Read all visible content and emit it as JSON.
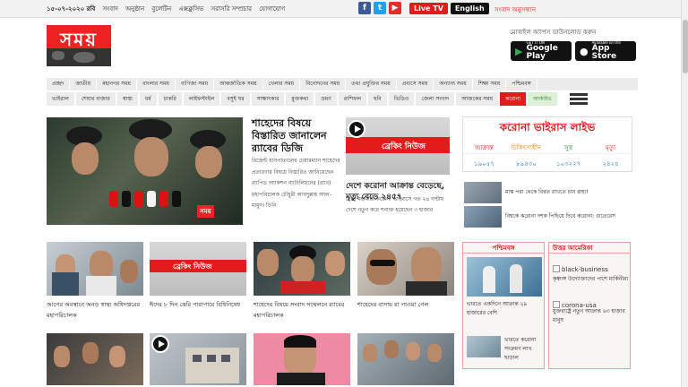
{
  "topbar": {
    "date": "১৫-০৭-২০২০ রবি",
    "links": [
      "সংবাদ",
      "অনুষ্ঠান",
      "বুলেটিন",
      "এক্সক্লুসিভ",
      "সরাসরি সম্প্রচার",
      "যোগাযোগ"
    ],
    "social": [
      {
        "icon": "facebook-icon",
        "glyph": "f",
        "color": "#3b5998"
      },
      {
        "icon": "twitter-icon",
        "glyph": "t",
        "color": "#1da1f2"
      },
      {
        "icon": "youtube-icon",
        "glyph": "▶",
        "color": "#e52d27"
      }
    ],
    "live_tv": "Live TV",
    "english": "English",
    "subscribe": "সংবাদ অনুসন্ধান"
  },
  "header": {
    "logo_text": "সময়",
    "app_download": "মোবাইল অ্যাপস ডাউনলোড করুন",
    "google_play": {
      "small": "GET IT ON",
      "big": "Google Play"
    },
    "app_store": {
      "small": "Available on the",
      "big": "App Store"
    }
  },
  "nav1": [
    "প্রচ্ছদ",
    "জাতীয়",
    "মহানগর সময়",
    "বাংলার সময়",
    "বাণিজ্য সময়",
    "আন্তর্জাতিক সময়",
    "খেলার সময়",
    "বিনোদনের সময়",
    "তথ্য প্রযুক্তির সময়",
    "প্রবাসে সময়",
    "অন্যান্য সময়",
    "শিক্ষা সময়",
    "পশ্চিমবঙ্গ"
  ],
  "nav2": [
    "ভাইরাল",
    "শেয়ার বাজার",
    "স্বাস্থ্য",
    "ধর্ম",
    "চাকরি",
    "লাইফস্টাইল",
    "বসুই ঘর",
    "সাক্ষাৎকার",
    "মুক্তকথা",
    "ভ্রমণ",
    "রাশিফল",
    "ছবি",
    "ভিডিও",
    "জেলা সংবাদ",
    "আজকের সময়"
  ],
  "nav2_red": "করোনা",
  "nav2_green": "আর্কাইভ",
  "hero": {
    "tag": "সময়",
    "title": "শাহেদের বিষয়ে বিস্তারিত জানালেন র‍্যাবের ডিজি",
    "text": "রিজেন্ট হাসপাতালের চেয়ারম্যান শাহেদের প্রতারণার বিষয়ে বিস্তারিত জানিয়েছেন র‍্যাপিড অ্যাকশন ব্যাটালিয়নের (র‍্যাব) মহাপরিচালক চৌধুরী আবদুল্লাহ আল-মামুন। তিনি"
  },
  "breaking": "ব্রেকিং নিউজ",
  "mid": {
    "title": "দেশে করোনা আক্রান্ত বেড়েছে, মৃত্যু বেড়ে ২৪৫৭",
    "text": "দেশে মহামারী করোনা ভাইরাসে গত ২৪ ঘণ্টায় দেশে নতুন করে শনাক্ত হয়েছেন ৩ হাজার"
  },
  "corona": {
    "title": "করোনা ভাইরাস লাইভ",
    "labels": [
      "আক্রান্ত",
      "চিকিৎসাধীন",
      "সুস্থ",
      "মৃত্যু"
    ],
    "values": [
      "১৯০৫৭",
      "৮৯৪৩০",
      "১০৩২২৭",
      "২৪২৪"
    ]
  },
  "side": [
    "মাস্ক পরা থেকে বিরত রাখতে চান রাহা!",
    "বিশ্বকে করোনা দশক পিছিয়ে দিবে করোনা: গুতেরেস"
  ],
  "cards": [
    "আগের অবস্থানে অনড় স্বাস্থ্য অধিদপ্তরের মহাপরিচালক",
    "ঈদের ৮ দিন কেরি পারাপারে বিধিনিষেধ",
    "শাহেদের বিষয়ে সংবাদ সম্মেলনে র‍্যাবের মহাপরিচালক",
    "শাহেদের বাসায় যা পাওয়া গেল"
  ],
  "box_west": {
    "title": "পশ্চিমবঙ্গ",
    "t1": "ভারতে একদিনে আক্রান্ত ২৯ হাজারের বেশি",
    "t2": "ভারতে করোনা সংক্রমণ লাখ ছাড়াল"
  },
  "box_na": {
    "title": "উত্তর আমেরিকা",
    "img1": "black-business",
    "t1": "কৃষ্ণাঙ্গ উদ্যোক্তাদের পাশে মার্কিনীরা",
    "img2": "corona-usa",
    "t2": "যুক্তরাষ্ট্রে নতুন আক্রান্ত ৬৩ হাজার মানুষ"
  }
}
